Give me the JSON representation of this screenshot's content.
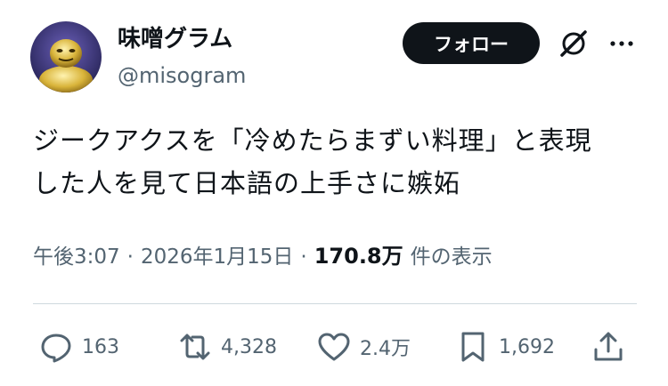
{
  "author": {
    "display_name": "味噌グラム",
    "handle": "@misogram",
    "follow_label": "フォロー"
  },
  "tweet": {
    "text_line1": "ジークアクスを「冷めたらまずい料理」と表現",
    "text_line2": "した人を見て日本語の上手さに嫉妬"
  },
  "meta": {
    "time": "午後3:07",
    "separator": "·",
    "date": "2026年1月15日",
    "views_count": "170.8万",
    "views_label": "件の表示"
  },
  "actions": {
    "replies": "163",
    "reposts": "4,328",
    "likes": "2.4万",
    "bookmarks": "1,692"
  },
  "icons": [
    "grok-icon",
    "more-icon",
    "reply-icon",
    "repost-icon",
    "like-icon",
    "bookmark-icon",
    "share-icon"
  ],
  "colors": {
    "text": "#0f1419",
    "secondary": "#536471",
    "button_bg": "#0f1419",
    "divider": "#cfd9de"
  }
}
